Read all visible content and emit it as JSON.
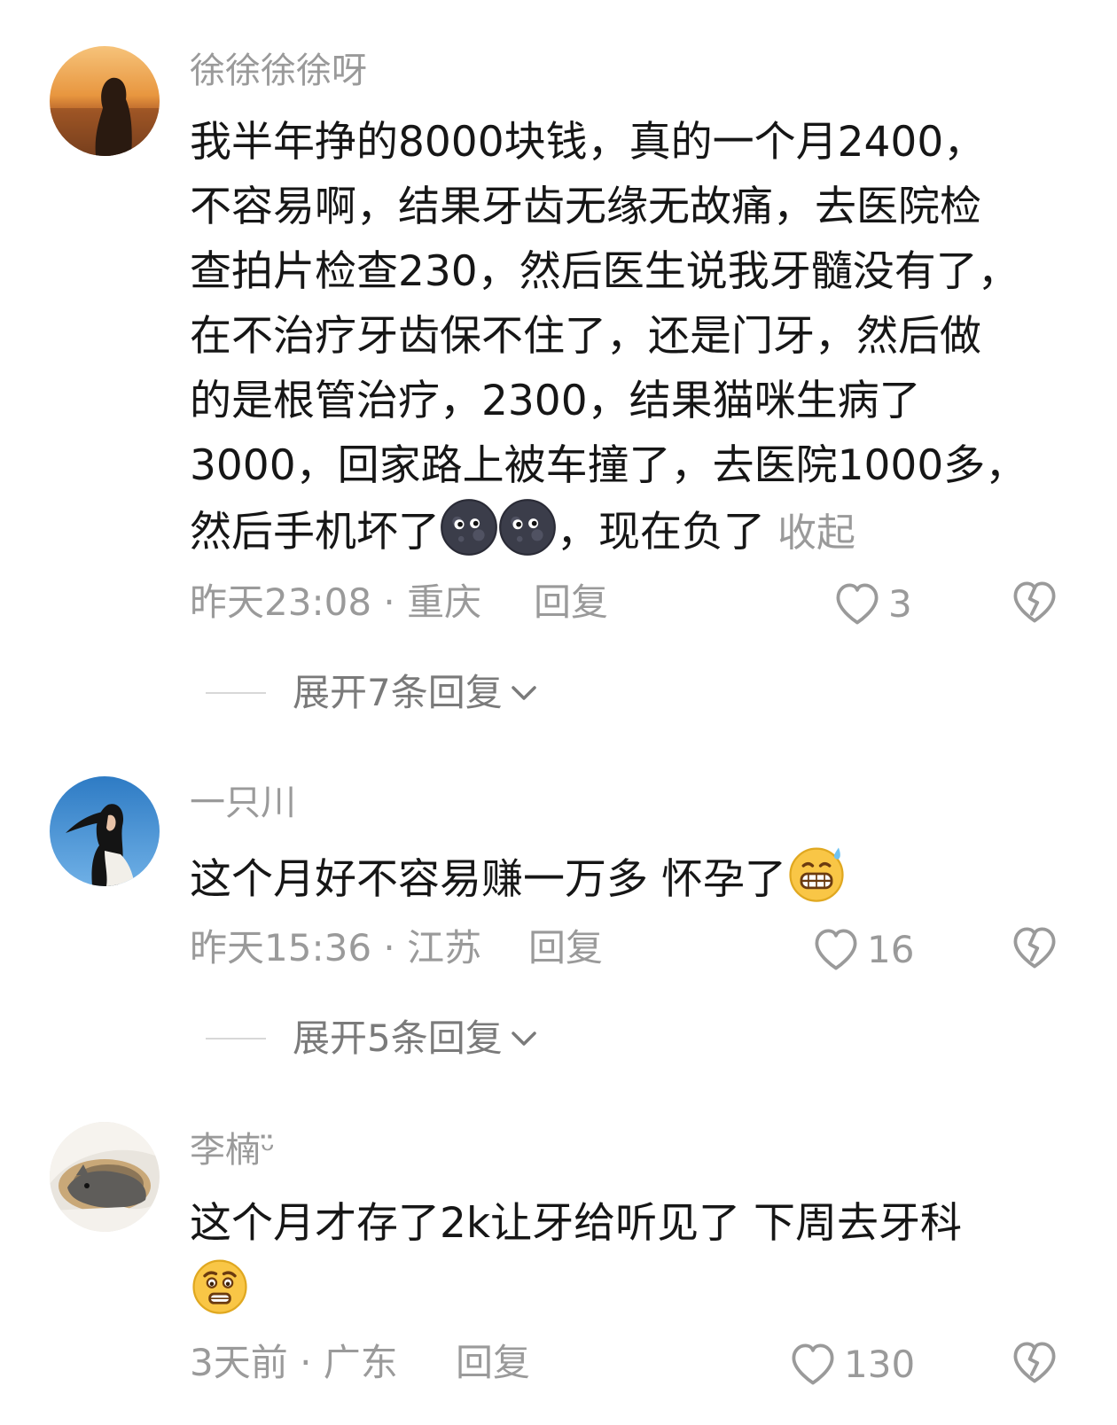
{
  "comments": [
    {
      "username": "徐徐徐徐呀",
      "text_lines": [
        "我半年挣的8000块钱，真的一个月2400，",
        "不容易啊，结果牙齿无缘无故痛，去医院检",
        "查拍片检查230，然后医生说我牙髓没有了，",
        "在不治疗牙齿保不住了，还是门牙，然后做",
        "的是根管治疗，2300，结果猫咪生病了",
        "3000，回家路上被车撞了，去医院1000多，",
        "然后手机坏了"
      ],
      "text_tail": "，现在负了",
      "collapse": "收起",
      "time_location": "昨天23:08 · 重庆",
      "reply": "回复",
      "likes": "3",
      "expand": "展开7条回复"
    },
    {
      "username": "一只川",
      "text_lines": [
        "这个月好不容易赚一万多 怀孕了"
      ],
      "time_location": "昨天15:36 · 江苏",
      "reply": "回复",
      "likes": "16",
      "expand": "展开5条回复"
    },
    {
      "username": "李楠ᵕ̈",
      "text_lines": [
        "这个月才存了2k让牙给听见了 下周去牙科"
      ],
      "time_location": "3天前 · 广东",
      "reply": "回复",
      "likes": "130"
    }
  ],
  "icons": {
    "like": "heart-outline-icon",
    "dislike": "broken-heart-icon",
    "expand": "chevron-down-icon"
  },
  "colors": {
    "muted": "#9a9a9a",
    "text": "#161616"
  }
}
